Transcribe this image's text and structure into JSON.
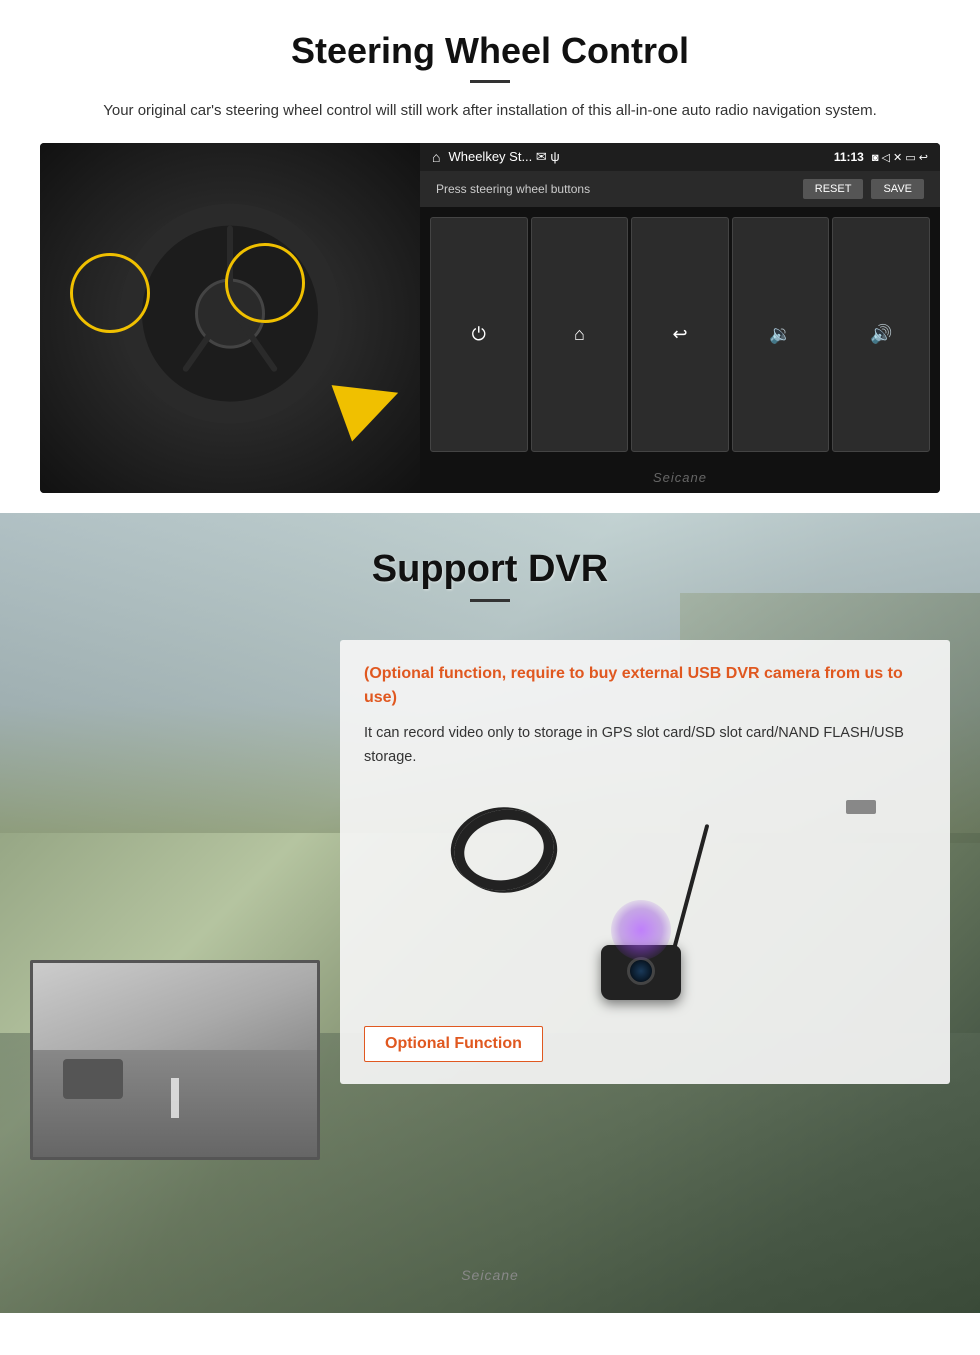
{
  "swc": {
    "title": "Steering Wheel Control",
    "subtitle": "Your original car's steering wheel control will still work after installation of this all-in-one auto radio navigation system.",
    "screen": {
      "statusbar": {
        "home_icon": "⌂",
        "title": "Wheelkey St... ✉ ψ",
        "time": "11:13",
        "icons": "◙ ◁ ✕ ▭ ↩"
      },
      "instruction": "Press steering wheel buttons",
      "reset_label": "RESET",
      "save_label": "SAVE",
      "controls": [
        "⏻",
        "⌂",
        "↩",
        "◀+",
        "◀+"
      ]
    },
    "watermark": "Seicane"
  },
  "dvr": {
    "title": "Support DVR",
    "optional_text": "(Optional function, require to buy external USB DVR camera from us to use)",
    "description": "It can record video only to storage in GPS slot card/SD slot card/NAND FLASH/USB storage.",
    "optional_badge_label": "Optional Function",
    "watermark": "Seicane"
  }
}
